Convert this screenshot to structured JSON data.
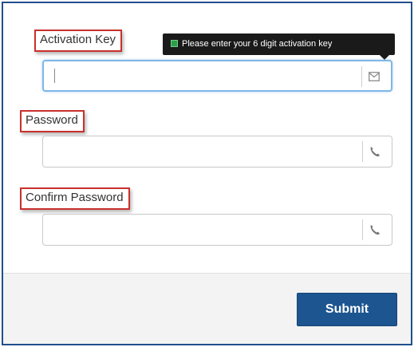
{
  "form": {
    "activation_key": {
      "label": "Activation Key",
      "value": "",
      "placeholder": "",
      "icon": "envelope-icon"
    },
    "tooltip": {
      "text": "Please enter your 6 digit activation key",
      "icon": "info-square-icon"
    },
    "password": {
      "label": "Password",
      "value": "",
      "placeholder": "",
      "icon": "phone-icon"
    },
    "confirm_password": {
      "label": "Confirm Password",
      "value": "",
      "placeholder": "",
      "icon": "phone-icon"
    },
    "submit_label": "Submit"
  },
  "colors": {
    "frame_border": "#1f4e8c",
    "label_highlight": "#c9302c",
    "focus_border": "#7fb6e8",
    "tooltip_bg": "#1a1a1a",
    "submit_bg": "#1c5590",
    "footer_bg": "#f3f3f3"
  }
}
